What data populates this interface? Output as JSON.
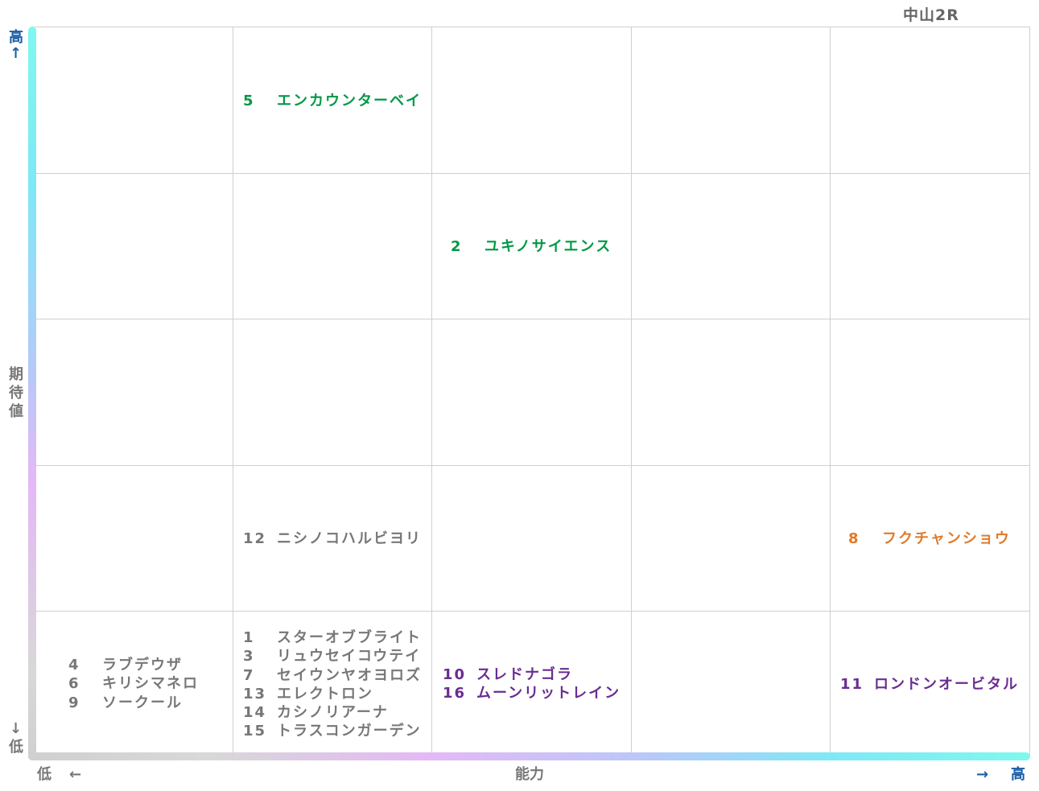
{
  "title": "中山2R",
  "axes": {
    "y_label": "期待値",
    "y_high": "高",
    "y_low": "低",
    "y_up_arrow": "↑",
    "y_down_arrow": "↓",
    "x_label": "能力",
    "x_low": "低",
    "x_high": "高",
    "x_left_arrow": "←",
    "x_right_arrow": "→"
  },
  "colors": {
    "green": "#009944",
    "gray": "#777777",
    "orange": "#e07a2a",
    "purple": "#6a2c91",
    "axis_blue": "#1a5fa8"
  },
  "chart_data": {
    "type": "table",
    "title": "中山2R",
    "xlabel": "能力",
    "ylabel": "期待値",
    "grid": {
      "columns": 5,
      "rows": 5
    },
    "cells": [
      {
        "col": 2,
        "row": 5,
        "color": "green",
        "horses": [
          {
            "num": "5",
            "name": "エンカウンターベイ"
          }
        ]
      },
      {
        "col": 3,
        "row": 4,
        "color": "green",
        "horses": [
          {
            "num": "2",
            "name": "ユキノサイエンス"
          }
        ]
      },
      {
        "col": 2,
        "row": 2,
        "color": "gray",
        "horses": [
          {
            "num": "12",
            "name": "ニシノコハルビヨリ"
          }
        ]
      },
      {
        "col": 5,
        "row": 2,
        "color": "orange",
        "horses": [
          {
            "num": "8",
            "name": "フクチャンショウ"
          }
        ]
      },
      {
        "col": 1,
        "row": 1,
        "color": "gray",
        "horses": [
          {
            "num": "4",
            "name": "ラブデウザ"
          },
          {
            "num": "6",
            "name": "キリシマネロ"
          },
          {
            "num": "9",
            "name": "ソークール"
          }
        ]
      },
      {
        "col": 2,
        "row": 1,
        "color": "gray",
        "horses": [
          {
            "num": "1",
            "name": "スターオブブライト"
          },
          {
            "num": "3",
            "name": "リュウセイコウテイ"
          },
          {
            "num": "7",
            "name": "セイウンヤオヨロズ"
          },
          {
            "num": "13",
            "name": "エレクトロン"
          },
          {
            "num": "14",
            "name": "カシノリアーナ"
          },
          {
            "num": "15",
            "name": "トラスコンガーデン"
          }
        ]
      },
      {
        "col": 3,
        "row": 1,
        "color": "purple",
        "horses": [
          {
            "num": "10",
            "name": "スレドナゴラ"
          },
          {
            "num": "16",
            "name": "ムーンリットレイン"
          }
        ]
      },
      {
        "col": 5,
        "row": 1,
        "color": "purple",
        "horses": [
          {
            "num": "11",
            "name": "ロンドンオービタル"
          }
        ]
      }
    ]
  }
}
